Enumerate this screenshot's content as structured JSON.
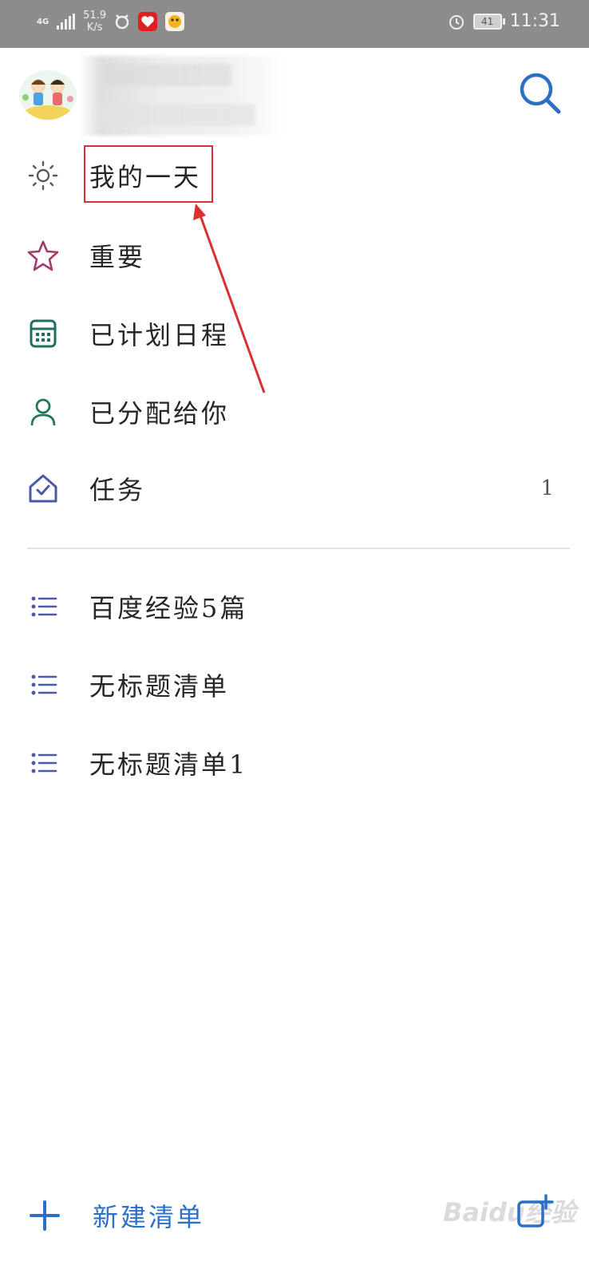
{
  "status_bar": {
    "network_type": "4G",
    "net_speed_value": "51.9",
    "net_speed_unit": "K/s",
    "battery": "41",
    "time": "11:31"
  },
  "header": {
    "search_icon": "search-icon",
    "avatar_icon": "avatar"
  },
  "smart_lists": [
    {
      "label": "我的一天",
      "icon": "sun-icon",
      "count": ""
    },
    {
      "label": "重要",
      "icon": "star-icon",
      "count": ""
    },
    {
      "label": "已计划日程",
      "icon": "calendar-icon",
      "count": ""
    },
    {
      "label": "已分配给你",
      "icon": "person-icon",
      "count": ""
    },
    {
      "label": "任务",
      "icon": "home-check-icon",
      "count": "1"
    }
  ],
  "custom_lists": [
    {
      "label": "百度经验5篇",
      "icon": "list-icon"
    },
    {
      "label": "无标题清单",
      "icon": "list-icon"
    },
    {
      "label": "无标题清单1",
      "icon": "list-icon"
    }
  ],
  "footer": {
    "new_list_label": "新建清单",
    "watermark": "Baidu经验"
  },
  "colors": {
    "status_bar_bg": "#8c8c8c",
    "accent_blue": "#2b6fc6",
    "annotation_red": "#d93030"
  }
}
